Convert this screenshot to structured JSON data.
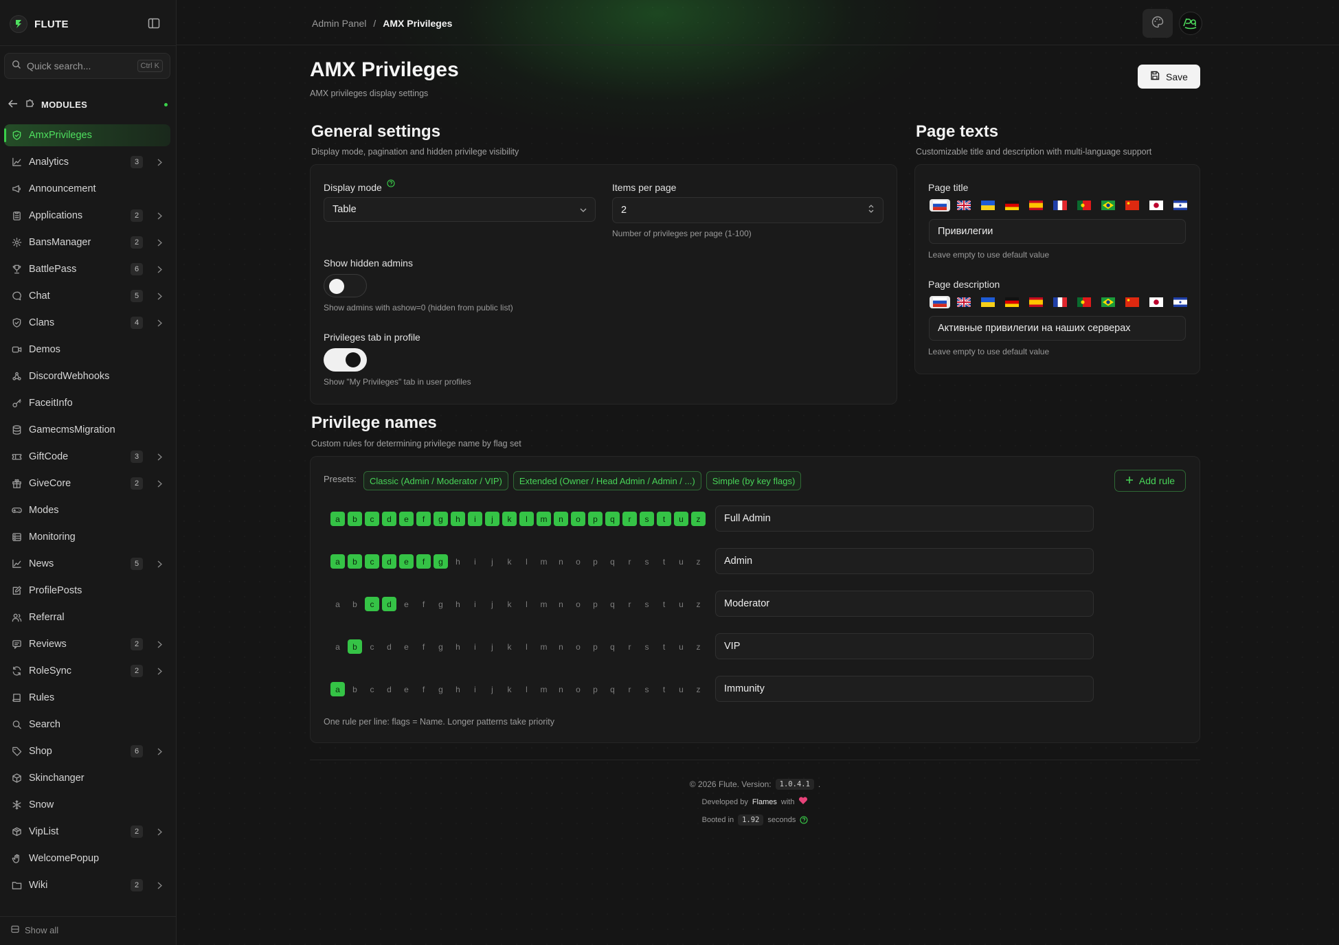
{
  "app": {
    "name": "FLUTE"
  },
  "search": {
    "placeholder": "Quick search...",
    "shortcut": "Ctrl K"
  },
  "sidebar": {
    "section_label": "MODULES",
    "show_all": "Show all",
    "items": [
      {
        "label": "AmxPrivileges",
        "icon": "shield-icon",
        "badge": "",
        "chevron": false,
        "active": true
      },
      {
        "label": "Analytics",
        "icon": "chart-line-icon",
        "badge": "3",
        "chevron": true
      },
      {
        "label": "Announcement",
        "icon": "megaphone-icon",
        "badge": "",
        "chevron": false
      },
      {
        "label": "Applications",
        "icon": "clipboard-icon",
        "badge": "2",
        "chevron": true
      },
      {
        "label": "BansManager",
        "icon": "gear-icon",
        "badge": "2",
        "chevron": true
      },
      {
        "label": "BattlePass",
        "icon": "trophy-icon",
        "badge": "6",
        "chevron": true
      },
      {
        "label": "Chat",
        "icon": "chat-bubble-icon",
        "badge": "5",
        "chevron": true
      },
      {
        "label": "Clans",
        "icon": "shield-icon",
        "badge": "4",
        "chevron": true
      },
      {
        "label": "Demos",
        "icon": "video-icon",
        "badge": "",
        "chevron": false
      },
      {
        "label": "DiscordWebhooks",
        "icon": "webhook-icon",
        "badge": "",
        "chevron": false
      },
      {
        "label": "FaceitInfo",
        "icon": "key-icon",
        "badge": "",
        "chevron": false
      },
      {
        "label": "GamecmsMigration",
        "icon": "database-icon",
        "badge": "",
        "chevron": false
      },
      {
        "label": "GiftCode",
        "icon": "ticket-icon",
        "badge": "3",
        "chevron": true
      },
      {
        "label": "GiveCore",
        "icon": "gift-icon",
        "badge": "2",
        "chevron": true
      },
      {
        "label": "Modes",
        "icon": "gamepad-icon",
        "badge": "",
        "chevron": false
      },
      {
        "label": "Monitoring",
        "icon": "server-icon",
        "badge": "",
        "chevron": false
      },
      {
        "label": "News",
        "icon": "chart-line-icon",
        "badge": "5",
        "chevron": true
      },
      {
        "label": "ProfilePosts",
        "icon": "edit-icon",
        "badge": "",
        "chevron": false
      },
      {
        "label": "Referral",
        "icon": "users-icon",
        "badge": "",
        "chevron": false
      },
      {
        "label": "Reviews",
        "icon": "reviews-icon",
        "badge": "2",
        "chevron": true
      },
      {
        "label": "RoleSync",
        "icon": "refresh-icon",
        "badge": "2",
        "chevron": true
      },
      {
        "label": "Rules",
        "icon": "book-icon",
        "badge": "",
        "chevron": false
      },
      {
        "label": "Search",
        "icon": "search-icon",
        "badge": "",
        "chevron": false
      },
      {
        "label": "Shop",
        "icon": "tag-icon",
        "badge": "6",
        "chevron": true
      },
      {
        "label": "Skinchanger",
        "icon": "cube-icon",
        "badge": "",
        "chevron": false
      },
      {
        "label": "Snow",
        "icon": "snowflake-icon",
        "badge": "",
        "chevron": false
      },
      {
        "label": "VipList",
        "icon": "box-icon",
        "badge": "2",
        "chevron": true
      },
      {
        "label": "WelcomePopup",
        "icon": "wave-icon",
        "badge": "",
        "chevron": false
      },
      {
        "label": "Wiki",
        "icon": "folder-icon",
        "badge": "2",
        "chevron": true
      }
    ]
  },
  "breadcrumb": {
    "parent": "Admin Panel",
    "separator": "/",
    "current": "AMX Privileges"
  },
  "page": {
    "title": "AMX Privileges",
    "subtitle": "AMX privileges display settings",
    "save_label": "Save"
  },
  "general": {
    "title": "General settings",
    "subtitle": "Display mode, pagination and hidden privilege visibility",
    "display_mode_label": "Display mode",
    "display_mode_value": "Table",
    "items_per_page_label": "Items per page",
    "items_per_page_value": "2",
    "items_per_page_hint": "Number of privileges per page (1-100)",
    "show_hidden_label": "Show hidden admins",
    "show_hidden_on": false,
    "show_hidden_hint": "Show admins with ashow=0 (hidden from public list)",
    "priv_tab_label": "Privileges tab in profile",
    "priv_tab_on": true,
    "priv_tab_hint": "Show \"My Privileges\" tab in user profiles"
  },
  "page_texts": {
    "title": "Page texts",
    "subtitle": "Customizable title and description with multi-language support",
    "page_title_label": "Page title",
    "page_title_value": "Привилегии",
    "page_title_hint": "Leave empty to use default value",
    "page_desc_label": "Page description",
    "page_desc_value": "Активные привилегии на наших серверах",
    "page_desc_hint": "Leave empty to use default value",
    "languages": [
      "ru",
      "en",
      "uk",
      "de",
      "es",
      "fr",
      "pt",
      "br",
      "zh",
      "ja",
      "sr"
    ]
  },
  "privilege_names": {
    "title": "Privilege names",
    "subtitle": "Custom rules for determining privilege name by flag set",
    "presets_label": "Presets:",
    "presets": [
      "Classic (Admin / Moderator / VIP)",
      "Extended (Owner / Head Admin / Admin / ...)",
      "Simple (by key flags)"
    ],
    "add_rule_label": "Add rule",
    "letters": [
      "a",
      "b",
      "c",
      "d",
      "e",
      "f",
      "g",
      "h",
      "i",
      "j",
      "k",
      "l",
      "m",
      "n",
      "o",
      "p",
      "q",
      "r",
      "s",
      "t",
      "u",
      "z"
    ],
    "rules": [
      {
        "flags": "abcdefghijklmnopqrstuz",
        "name": "Full Admin"
      },
      {
        "flags": "abcdefg",
        "name": "Admin"
      },
      {
        "flags": "cd",
        "name": "Moderator"
      },
      {
        "flags": "b",
        "name": "VIP"
      },
      {
        "flags": "a",
        "name": "Immunity"
      }
    ],
    "footnote": "One rule per line: flags = Name. Longer patterns take priority"
  },
  "footer": {
    "copyright": "© 2026 Flute. Version:",
    "version": "1.0.4.1",
    "version_suffix": ".",
    "developed_by": "Developed by",
    "author": "Flames",
    "with": "with",
    "booted_in": "Booted in",
    "boot_time": "1.92",
    "seconds": "seconds"
  },
  "colors": {
    "accent": "#35c346",
    "background": "#151515",
    "sidebar_active": "#2e7834"
  }
}
